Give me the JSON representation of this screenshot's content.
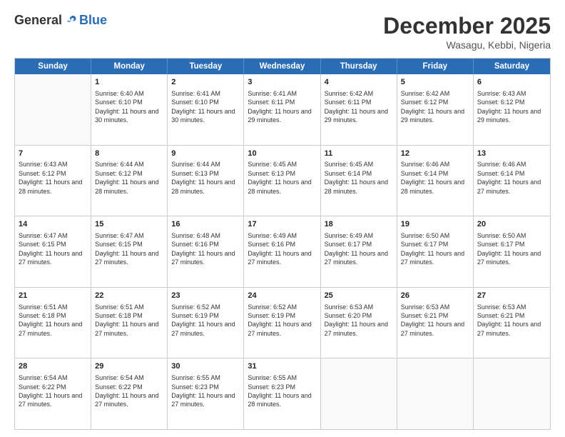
{
  "header": {
    "logo_general": "General",
    "logo_blue": "Blue",
    "month_title": "December 2025",
    "location": "Wasagu, Kebbi, Nigeria"
  },
  "weekdays": [
    "Sunday",
    "Monday",
    "Tuesday",
    "Wednesday",
    "Thursday",
    "Friday",
    "Saturday"
  ],
  "rows": [
    [
      {
        "day": "",
        "sunrise": "",
        "sunset": "",
        "daylight": ""
      },
      {
        "day": "1",
        "sunrise": "Sunrise: 6:40 AM",
        "sunset": "Sunset: 6:10 PM",
        "daylight": "Daylight: 11 hours and 30 minutes."
      },
      {
        "day": "2",
        "sunrise": "Sunrise: 6:41 AM",
        "sunset": "Sunset: 6:10 PM",
        "daylight": "Daylight: 11 hours and 30 minutes."
      },
      {
        "day": "3",
        "sunrise": "Sunrise: 6:41 AM",
        "sunset": "Sunset: 6:11 PM",
        "daylight": "Daylight: 11 hours and 29 minutes."
      },
      {
        "day": "4",
        "sunrise": "Sunrise: 6:42 AM",
        "sunset": "Sunset: 6:11 PM",
        "daylight": "Daylight: 11 hours and 29 minutes."
      },
      {
        "day": "5",
        "sunrise": "Sunrise: 6:42 AM",
        "sunset": "Sunset: 6:12 PM",
        "daylight": "Daylight: 11 hours and 29 minutes."
      },
      {
        "day": "6",
        "sunrise": "Sunrise: 6:43 AM",
        "sunset": "Sunset: 6:12 PM",
        "daylight": "Daylight: 11 hours and 29 minutes."
      }
    ],
    [
      {
        "day": "7",
        "sunrise": "Sunrise: 6:43 AM",
        "sunset": "Sunset: 6:12 PM",
        "daylight": "Daylight: 11 hours and 28 minutes."
      },
      {
        "day": "8",
        "sunrise": "Sunrise: 6:44 AM",
        "sunset": "Sunset: 6:12 PM",
        "daylight": "Daylight: 11 hours and 28 minutes."
      },
      {
        "day": "9",
        "sunrise": "Sunrise: 6:44 AM",
        "sunset": "Sunset: 6:13 PM",
        "daylight": "Daylight: 11 hours and 28 minutes."
      },
      {
        "day": "10",
        "sunrise": "Sunrise: 6:45 AM",
        "sunset": "Sunset: 6:13 PM",
        "daylight": "Daylight: 11 hours and 28 minutes."
      },
      {
        "day": "11",
        "sunrise": "Sunrise: 6:45 AM",
        "sunset": "Sunset: 6:14 PM",
        "daylight": "Daylight: 11 hours and 28 minutes."
      },
      {
        "day": "12",
        "sunrise": "Sunrise: 6:46 AM",
        "sunset": "Sunset: 6:14 PM",
        "daylight": "Daylight: 11 hours and 28 minutes."
      },
      {
        "day": "13",
        "sunrise": "Sunrise: 6:46 AM",
        "sunset": "Sunset: 6:14 PM",
        "daylight": "Daylight: 11 hours and 27 minutes."
      }
    ],
    [
      {
        "day": "14",
        "sunrise": "Sunrise: 6:47 AM",
        "sunset": "Sunset: 6:15 PM",
        "daylight": "Daylight: 11 hours and 27 minutes."
      },
      {
        "day": "15",
        "sunrise": "Sunrise: 6:47 AM",
        "sunset": "Sunset: 6:15 PM",
        "daylight": "Daylight: 11 hours and 27 minutes."
      },
      {
        "day": "16",
        "sunrise": "Sunrise: 6:48 AM",
        "sunset": "Sunset: 6:16 PM",
        "daylight": "Daylight: 11 hours and 27 minutes."
      },
      {
        "day": "17",
        "sunrise": "Sunrise: 6:49 AM",
        "sunset": "Sunset: 6:16 PM",
        "daylight": "Daylight: 11 hours and 27 minutes."
      },
      {
        "day": "18",
        "sunrise": "Sunrise: 6:49 AM",
        "sunset": "Sunset: 6:17 PM",
        "daylight": "Daylight: 11 hours and 27 minutes."
      },
      {
        "day": "19",
        "sunrise": "Sunrise: 6:50 AM",
        "sunset": "Sunset: 6:17 PM",
        "daylight": "Daylight: 11 hours and 27 minutes."
      },
      {
        "day": "20",
        "sunrise": "Sunrise: 6:50 AM",
        "sunset": "Sunset: 6:17 PM",
        "daylight": "Daylight: 11 hours and 27 minutes."
      }
    ],
    [
      {
        "day": "21",
        "sunrise": "Sunrise: 6:51 AM",
        "sunset": "Sunset: 6:18 PM",
        "daylight": "Daylight: 11 hours and 27 minutes."
      },
      {
        "day": "22",
        "sunrise": "Sunrise: 6:51 AM",
        "sunset": "Sunset: 6:18 PM",
        "daylight": "Daylight: 11 hours and 27 minutes."
      },
      {
        "day": "23",
        "sunrise": "Sunrise: 6:52 AM",
        "sunset": "Sunset: 6:19 PM",
        "daylight": "Daylight: 11 hours and 27 minutes."
      },
      {
        "day": "24",
        "sunrise": "Sunrise: 6:52 AM",
        "sunset": "Sunset: 6:19 PM",
        "daylight": "Daylight: 11 hours and 27 minutes."
      },
      {
        "day": "25",
        "sunrise": "Sunrise: 6:53 AM",
        "sunset": "Sunset: 6:20 PM",
        "daylight": "Daylight: 11 hours and 27 minutes."
      },
      {
        "day": "26",
        "sunrise": "Sunrise: 6:53 AM",
        "sunset": "Sunset: 6:21 PM",
        "daylight": "Daylight: 11 hours and 27 minutes."
      },
      {
        "day": "27",
        "sunrise": "Sunrise: 6:53 AM",
        "sunset": "Sunset: 6:21 PM",
        "daylight": "Daylight: 11 hours and 27 minutes."
      }
    ],
    [
      {
        "day": "28",
        "sunrise": "Sunrise: 6:54 AM",
        "sunset": "Sunset: 6:22 PM",
        "daylight": "Daylight: 11 hours and 27 minutes."
      },
      {
        "day": "29",
        "sunrise": "Sunrise: 6:54 AM",
        "sunset": "Sunset: 6:22 PM",
        "daylight": "Daylight: 11 hours and 27 minutes."
      },
      {
        "day": "30",
        "sunrise": "Sunrise: 6:55 AM",
        "sunset": "Sunset: 6:23 PM",
        "daylight": "Daylight: 11 hours and 27 minutes."
      },
      {
        "day": "31",
        "sunrise": "Sunrise: 6:55 AM",
        "sunset": "Sunset: 6:23 PM",
        "daylight": "Daylight: 11 hours and 28 minutes."
      },
      {
        "day": "",
        "sunrise": "",
        "sunset": "",
        "daylight": ""
      },
      {
        "day": "",
        "sunrise": "",
        "sunset": "",
        "daylight": ""
      },
      {
        "day": "",
        "sunrise": "",
        "sunset": "",
        "daylight": ""
      }
    ]
  ]
}
